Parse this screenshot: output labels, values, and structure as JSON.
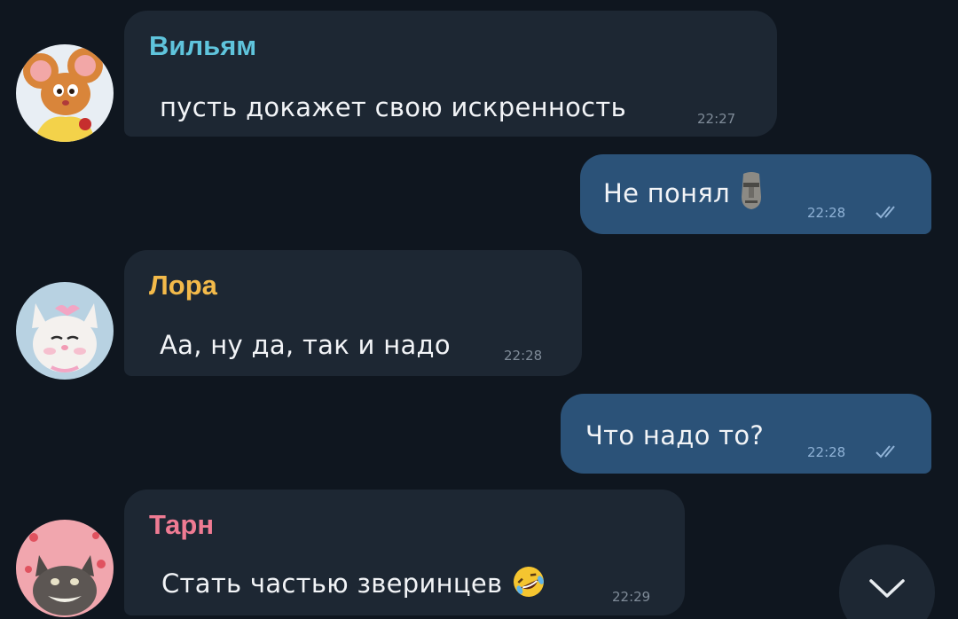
{
  "colors": {
    "background": "#0f161f",
    "incoming_bubble": "#1d2733",
    "outgoing_bubble": "#2b5278",
    "name_william": "#5fc4dc",
    "name_lora": "#f3ba4a",
    "name_tarn": "#ef7b93",
    "read_checks": "#8fb2d6"
  },
  "messages": [
    {
      "direction": "incoming",
      "sender": "Вильям",
      "text": "пусть докажет свою искренность",
      "time": "22:27",
      "avatar_icon": "mouse-avatar-icon"
    },
    {
      "direction": "outgoing",
      "text": "Не понял",
      "emoji": "moai-icon",
      "time": "22:28",
      "status": "read"
    },
    {
      "direction": "incoming",
      "sender": "Лора",
      "text": "Аа, ну да, так и надо",
      "time": "22:28",
      "avatar_icon": "white-cat-avatar-icon"
    },
    {
      "direction": "outgoing",
      "text": "Что надо то?",
      "time": "22:28",
      "status": "read"
    },
    {
      "direction": "incoming",
      "sender": "Тарн",
      "text": "Стать частью зверинцев",
      "emoji": "rofl-emoji-icon",
      "time": "22:29",
      "avatar_icon": "grinning-cat-avatar-icon"
    }
  ],
  "scroll_button": {
    "icon": "chevron-down-icon"
  }
}
